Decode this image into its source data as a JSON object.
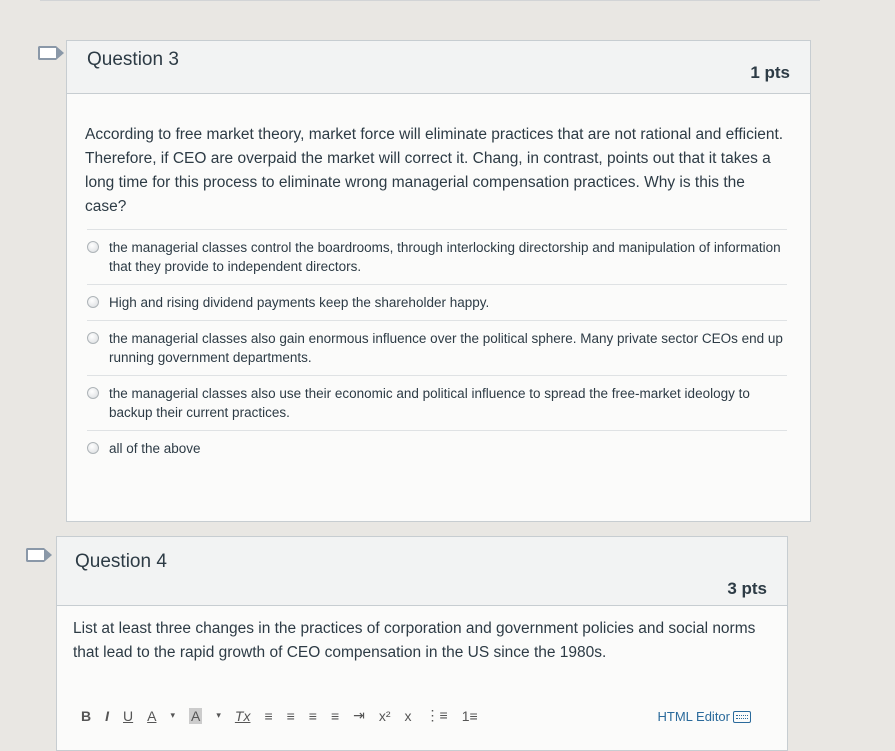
{
  "q3": {
    "title": "Question 3",
    "points": "1 pts",
    "text": "According to free market theory, market force will eliminate practices that are not rational and efficient. Therefore, if CEO are overpaid the market will correct it. Chang, in contrast, points out that it takes a long time for this process to eliminate wrong managerial compensation practices. Why is this the case?",
    "answers": [
      "the managerial classes control the boardrooms, through interlocking directorship and manipulation of information that they provide to independent directors.",
      "High and rising dividend payments keep the shareholder happy.",
      "the managerial classes also gain enormous influence over the political sphere. Many private sector CEOs end up running government departments.",
      "the managerial classes also use their economic and political influence to spread the free-market ideology to backup their current practices.",
      "all of the above"
    ]
  },
  "q4": {
    "title": "Question 4",
    "points": "3 pts",
    "text": "List at least three changes in the practices of corporation and government policies and social norms that lead to the rapid growth of CEO compensation in the US since the 1980s."
  },
  "toolbar": {
    "bold": "B",
    "italic": "I",
    "underline": "U",
    "font_color": "A",
    "bg_color": "A",
    "clear_format": "Tx",
    "align_left": "≡",
    "align_center": "≡",
    "align_right": "≡",
    "justify": "≡",
    "indent": "⇥",
    "superscript": "x²",
    "subscript": "x",
    "bullet_list": "⋮≡",
    "numbered_list": "1≡",
    "html_editor": "HTML Editor"
  },
  "colors": {
    "link": "#2a6a9b",
    "text": "#2d3b45",
    "border": "#c7cdd1"
  }
}
